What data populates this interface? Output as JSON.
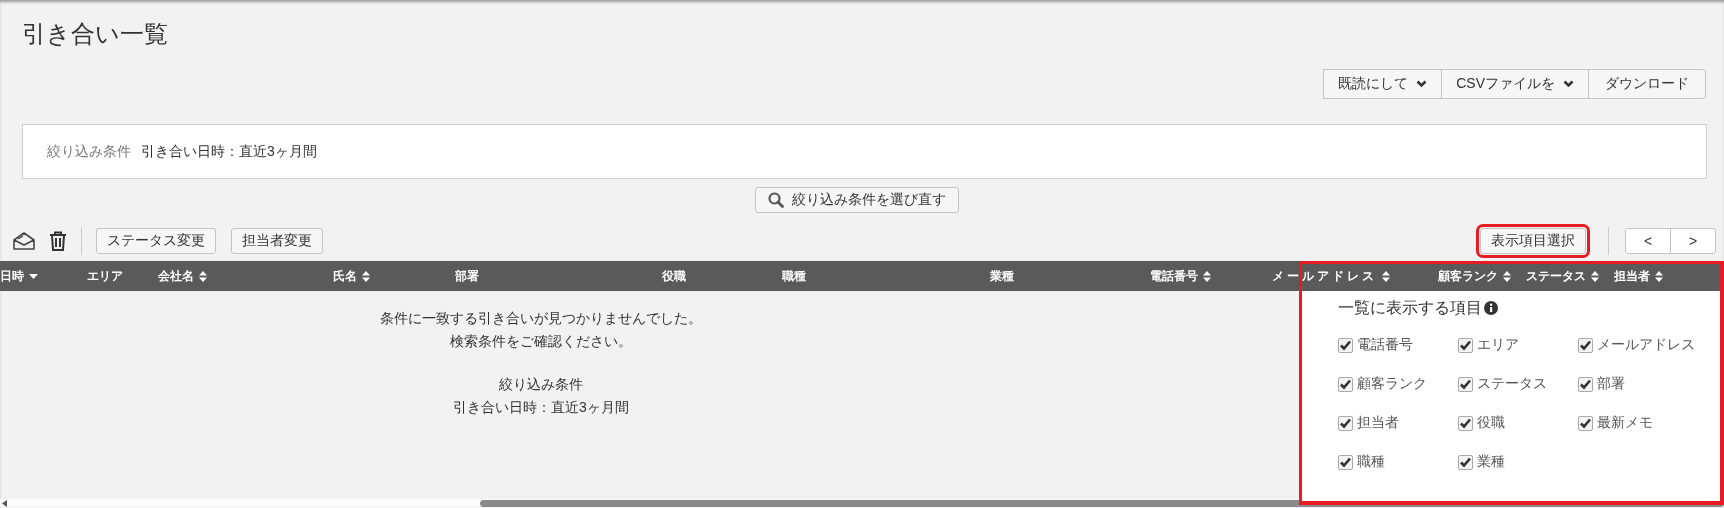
{
  "page": {
    "title": "引き合い一覧"
  },
  "actions": [
    {
      "label": "既読にして",
      "dropdown": true
    },
    {
      "label": "CSVファイルを",
      "dropdown": true
    },
    {
      "label": "ダウンロード",
      "dropdown": false
    }
  ],
  "filter": {
    "label": "絞り込み条件",
    "value": "引き合い日時：直近3ヶ月間"
  },
  "reselect_button": "絞り込み条件を選び直す",
  "toolbar": {
    "buttons": [
      "ステータス変更",
      "担当者変更"
    ],
    "column_select": {
      "label": "表示項目選択",
      "highlighted": true
    },
    "pager": [
      "<",
      ">"
    ]
  },
  "table": {
    "columns": [
      {
        "label": "日時",
        "sortable": true,
        "sorted": true
      },
      {
        "label": "エリア",
        "sortable": false,
        "sorted": false
      },
      {
        "label": "会社名",
        "sortable": true,
        "sorted": false
      },
      {
        "label": "氏名",
        "sortable": true,
        "sorted": false
      },
      {
        "label": "部署",
        "sortable": false,
        "sorted": false
      },
      {
        "label": "役職",
        "sortable": false,
        "sorted": false
      },
      {
        "label": "職種",
        "sortable": false,
        "sorted": false
      },
      {
        "label": "業種",
        "sortable": false,
        "sorted": false
      },
      {
        "label": "電話番号",
        "sortable": true,
        "sorted": false
      },
      {
        "label": "メールアドレス",
        "sortable": true,
        "sorted": false
      },
      {
        "label": "顧客ランク",
        "sortable": true,
        "sorted": false
      },
      {
        "label": "ステータス",
        "sortable": true,
        "sorted": false
      },
      {
        "label": "担当者",
        "sortable": true,
        "sorted": false
      }
    ]
  },
  "empty_state": {
    "message": [
      "条件に一致する引き合いが見つかりませんでした。",
      "検索条件をご確認ください。"
    ],
    "filter_label": "絞り込み条件",
    "filter_value": "引き合い日時：直近3ヶ月間"
  },
  "column_picker": {
    "title": "一覧に表示する項目",
    "highlighted": true,
    "items": [
      {
        "label": "電話番号",
        "checked": true
      },
      {
        "label": "エリア",
        "checked": true
      },
      {
        "label": "メールアドレス",
        "checked": true
      },
      {
        "label": "顧客ランク",
        "checked": true
      },
      {
        "label": "ステータス",
        "checked": true
      },
      {
        "label": "部署",
        "checked": true
      },
      {
        "label": "担当者",
        "checked": true
      },
      {
        "label": "役職",
        "checked": true
      },
      {
        "label": "最新メモ",
        "checked": true
      },
      {
        "label": "職種",
        "checked": true
      },
      {
        "label": "業種",
        "checked": true
      }
    ]
  }
}
